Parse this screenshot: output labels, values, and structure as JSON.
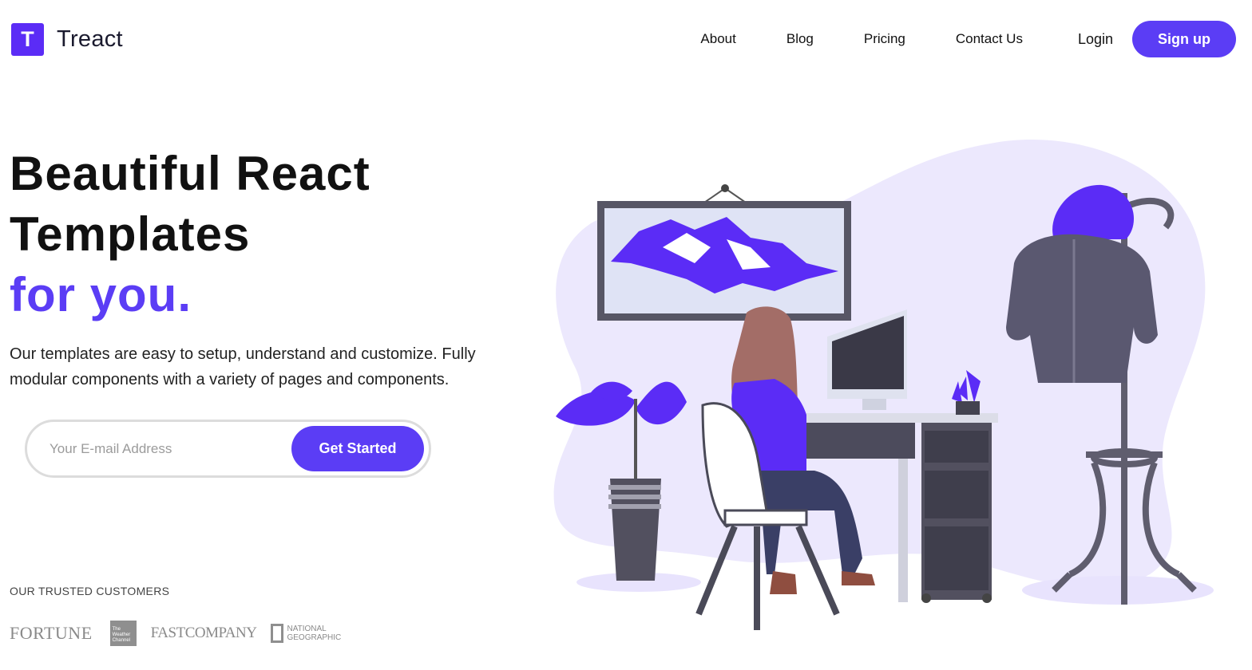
{
  "brand": {
    "logo_letter": "T",
    "name": "Treact",
    "accent_color": "#5b3df5"
  },
  "nav": {
    "links": [
      "About",
      "Blog",
      "Pricing",
      "Contact Us"
    ],
    "login_label": "Login",
    "signup_label": "Sign up"
  },
  "hero": {
    "title_line1": "Beautiful React",
    "title_line2": "Templates",
    "title_accent": "for you.",
    "description": "Our templates are easy to setup, understand and customize. Fully modular components with a variety of pages and components."
  },
  "signup_form": {
    "email_placeholder": "Your E-mail Address",
    "email_value": "",
    "submit_label": "Get Started"
  },
  "customers": {
    "label": "OUR TRUSTED CUSTOMERS",
    "logos": {
      "fortune": "FORTUNE",
      "weather": "The Weather Channel",
      "fastcompany": "FASTCOMPANY",
      "natgeo": "NATIONAL GEOGRAPHIC"
    }
  }
}
